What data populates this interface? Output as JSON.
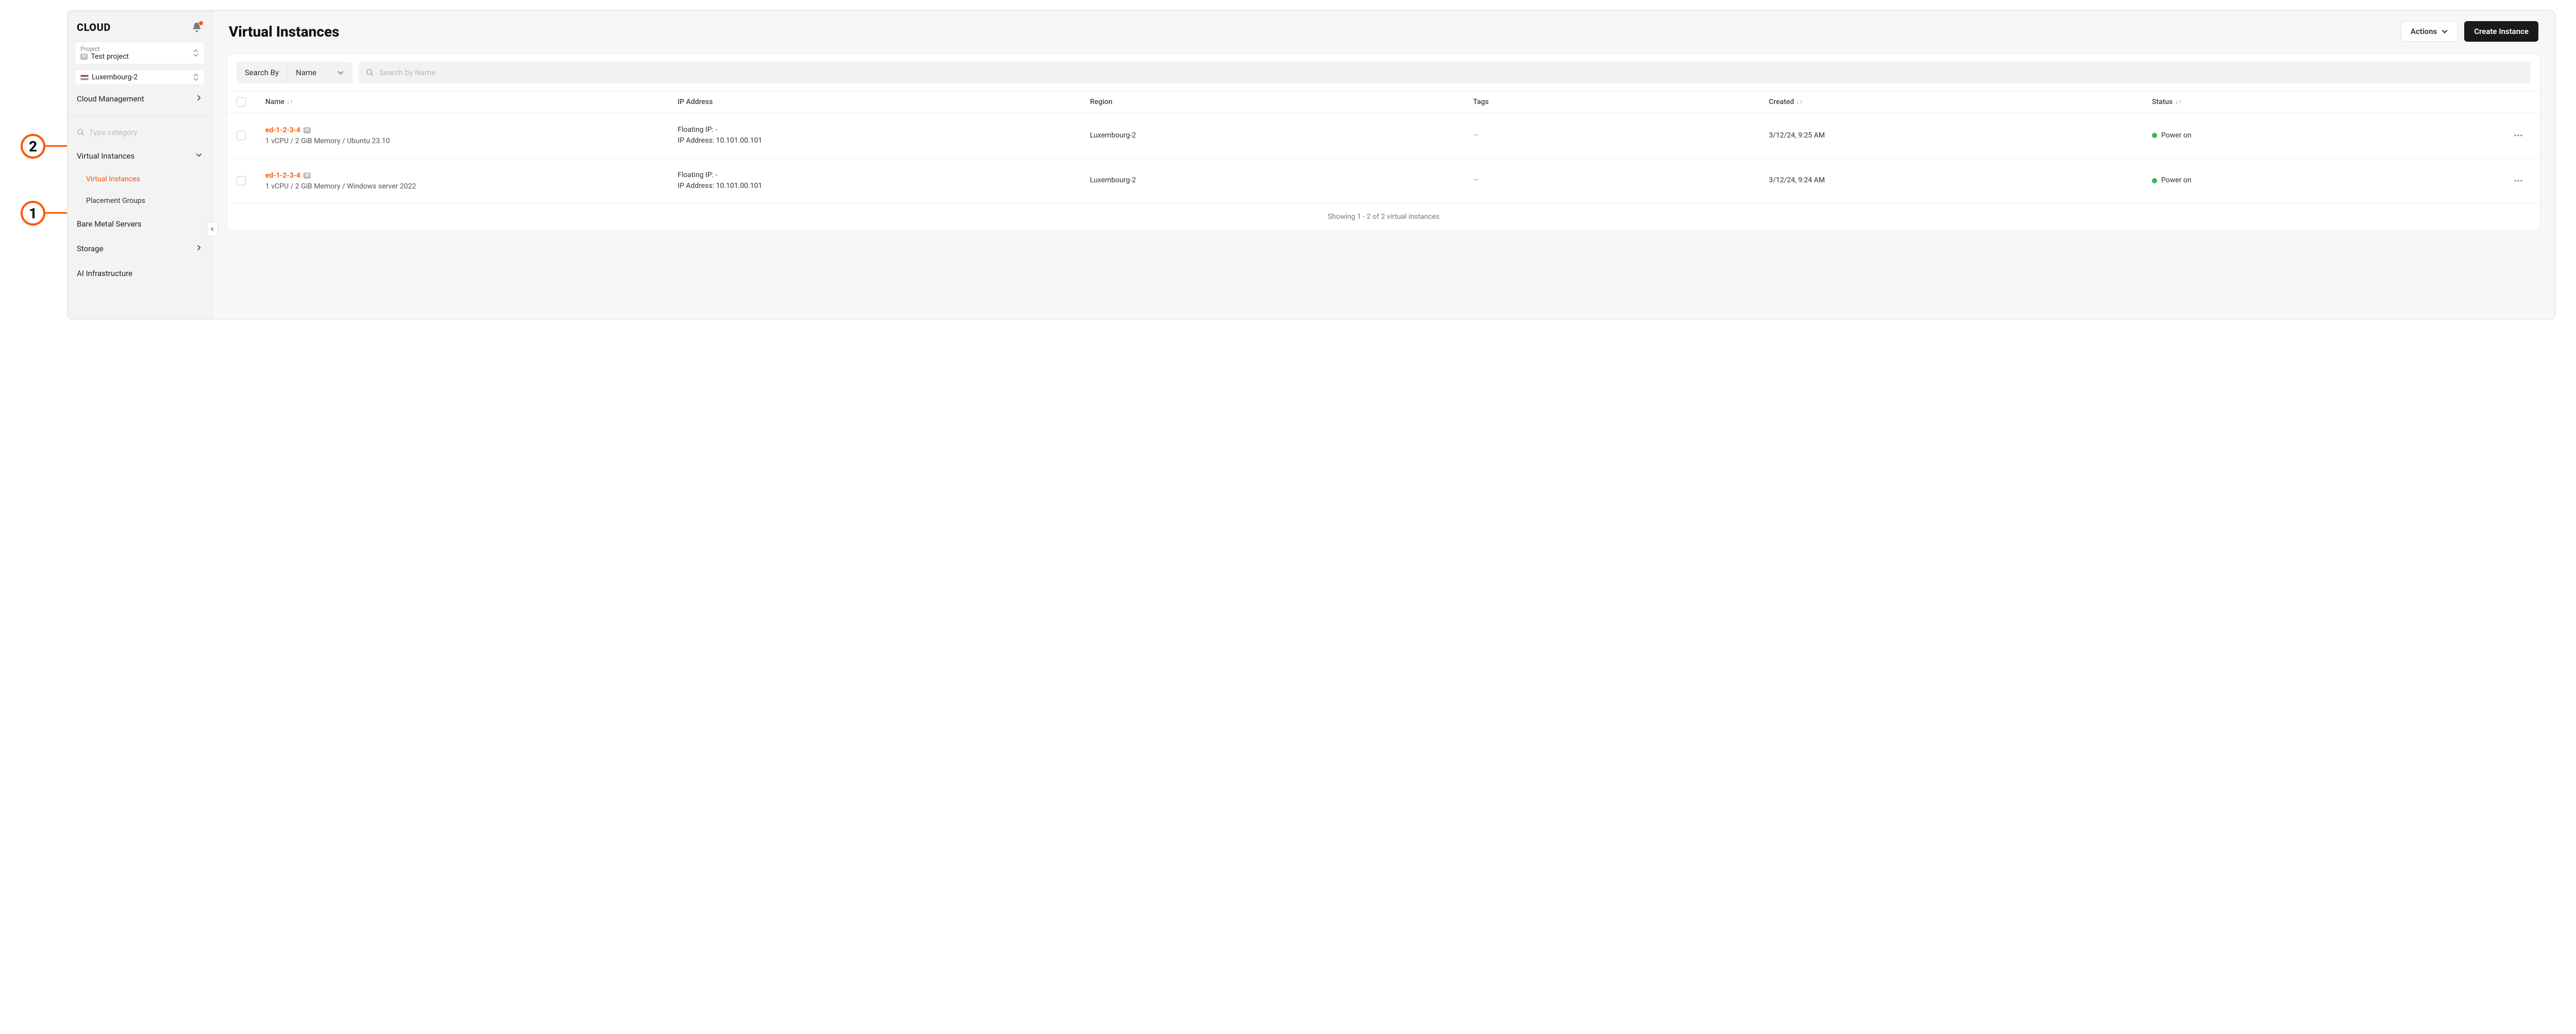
{
  "brand": "CLOUD",
  "selectors": {
    "project_label": "Project",
    "project_value": "Test project",
    "region_value": "Luxembourg-2"
  },
  "sidebar": {
    "cloud_management": "Cloud Management",
    "search_placeholder": "Type category",
    "items": {
      "virtual_instances": "Virtual Instances",
      "virtual_instances_sub": "Virtual Instances",
      "placement_groups": "Placement Groups",
      "bare_metal": "Bare Metal Servers",
      "storage": "Storage",
      "ai_infra": "AI Infrastructure"
    }
  },
  "header": {
    "title": "Virtual Instances",
    "actions_btn": "Actions",
    "create_btn": "Create Instance"
  },
  "filter": {
    "search_by_label": "Search By",
    "search_by_value": "Name",
    "search_placeholder": "Search by Name"
  },
  "columns": {
    "name": "Name",
    "ip": "IP Address",
    "region": "Region",
    "tags": "Tags",
    "created": "Created",
    "status": "Status"
  },
  "rows": [
    {
      "name": "ed-1-2-3-4",
      "specs": "1 vCPU / 2 GiB Memory / Ubuntu 23.10",
      "floating_ip_label": "Floating IP: -",
      "ip_label": "IP Address: 10.101.00.101",
      "region": "Luxembourg-2",
      "tags": "—",
      "created": "3/12/24, 9:25 AM",
      "status": "Power on"
    },
    {
      "name": "ed-1-2-3-4",
      "specs": "1 vCPU / 2 GiB Memory / Windows server 2022",
      "floating_ip_label": "Floating IP: -",
      "ip_label": "IP Address: 10.101.00.101",
      "region": "Luxembourg-2",
      "tags": "—",
      "created": "3/12/24, 9:24 AM",
      "status": "Power on"
    }
  ],
  "footer": "Showing 1 - 2 of 2 virtual instances",
  "annotations": {
    "one": "1",
    "two": "2"
  }
}
